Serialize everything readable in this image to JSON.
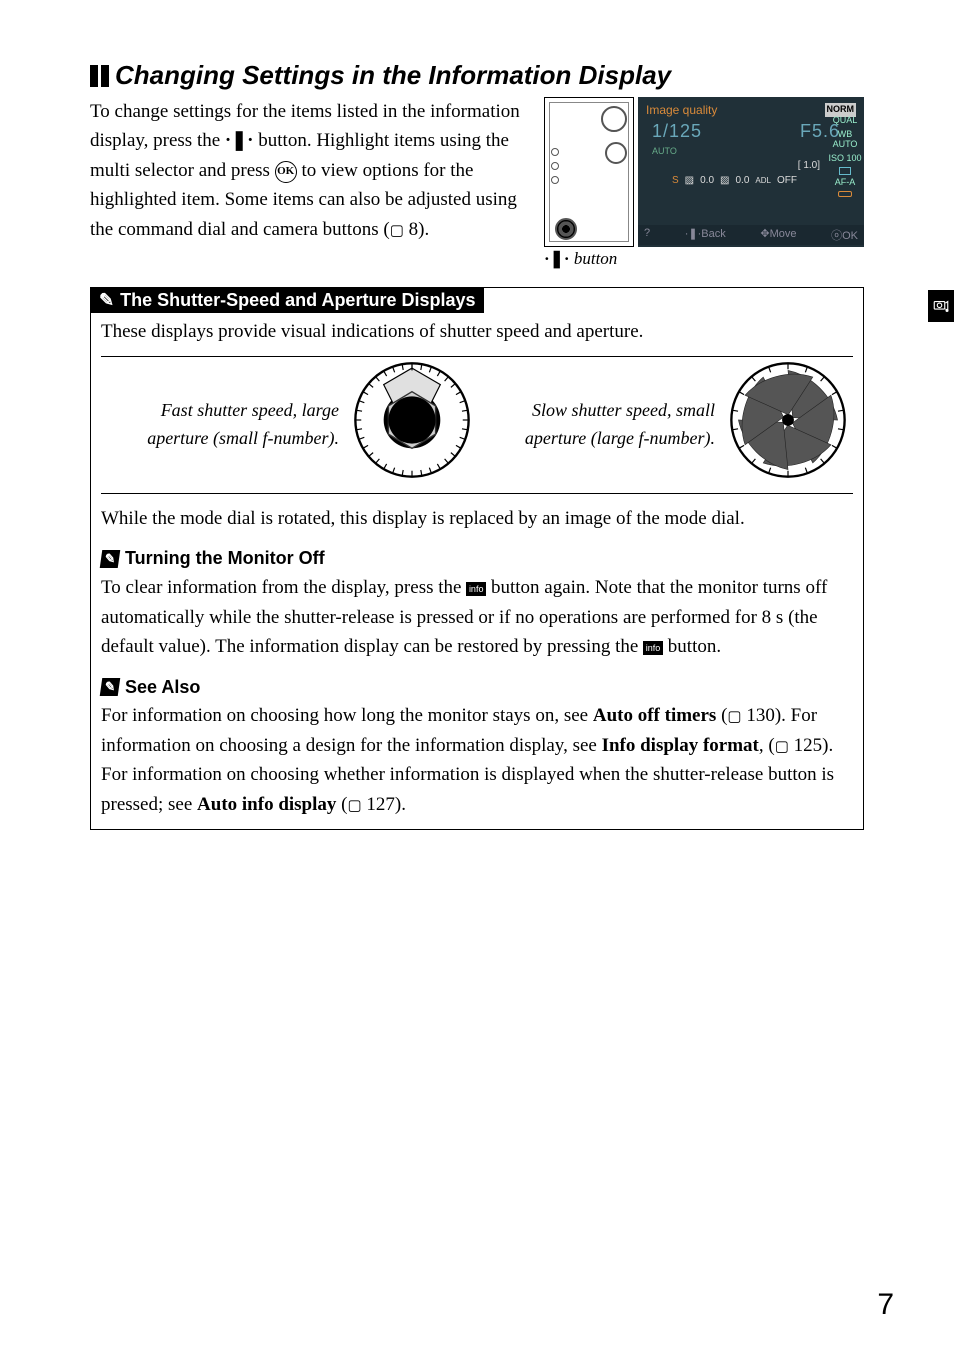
{
  "page_number": "7",
  "section": {
    "title": "Changing Settings in the Information Display",
    "intro": [
      "To change settings for the items listed in the information display, press the ",
      " button. Highlight items using the multi selector and press ",
      " to view options for the highlighted item.  Some items can also be adjusted using the command dial and camera buttons (",
      " 8)."
    ],
    "ok_label": "OK",
    "caption_button": " button"
  },
  "lcd": {
    "title": "Image quality",
    "norm": "NORM",
    "shutter": "1/125",
    "aperture": "F5.6",
    "auto": "AUTO",
    "scale_right": "1.0",
    "meter_vals": [
      "0.0",
      "0.0",
      "OFF"
    ],
    "sidebar": [
      "QUAL",
      "WB  AUTO",
      "ISO  100",
      "AF-A"
    ],
    "bottom": {
      "help": "?",
      "back": "Back",
      "move": "Move",
      "ok": "OK"
    }
  },
  "box1": {
    "title": "The Shutter-Speed and Aperture Displays",
    "line1": "These displays provide visual indications of shutter speed and aperture.",
    "fast_label": [
      "Fast shutter speed, large",
      "aperture (small f-number)."
    ],
    "slow_label": [
      "Slow shutter speed, small",
      "aperture (large f-number)."
    ],
    "footer": "While the mode dial is rotated, this display is replaced by an image of the mode dial."
  },
  "box2": {
    "title": "Turning the Monitor Off",
    "body": [
      "To clear information from the display, press the ",
      " button again.  Note that the monitor turns off automatically while the shutter-release is pressed or if no operations are performed for 8 s (the default value).  The information display can be restored by pressing the ",
      " button."
    ],
    "info_label": "info"
  },
  "box3": {
    "title": "See Also",
    "parts": [
      "For information on choosing how long the monitor stays on, see ",
      "Auto off timers",
      " (",
      " 130). For information on choosing a design for the information display, see ",
      "Info display format",
      ", (",
      " 125).  For information on choosing whether information is displayed when the shutter-release button is pressed; see ",
      "Auto info display",
      " (",
      " 127)."
    ]
  }
}
